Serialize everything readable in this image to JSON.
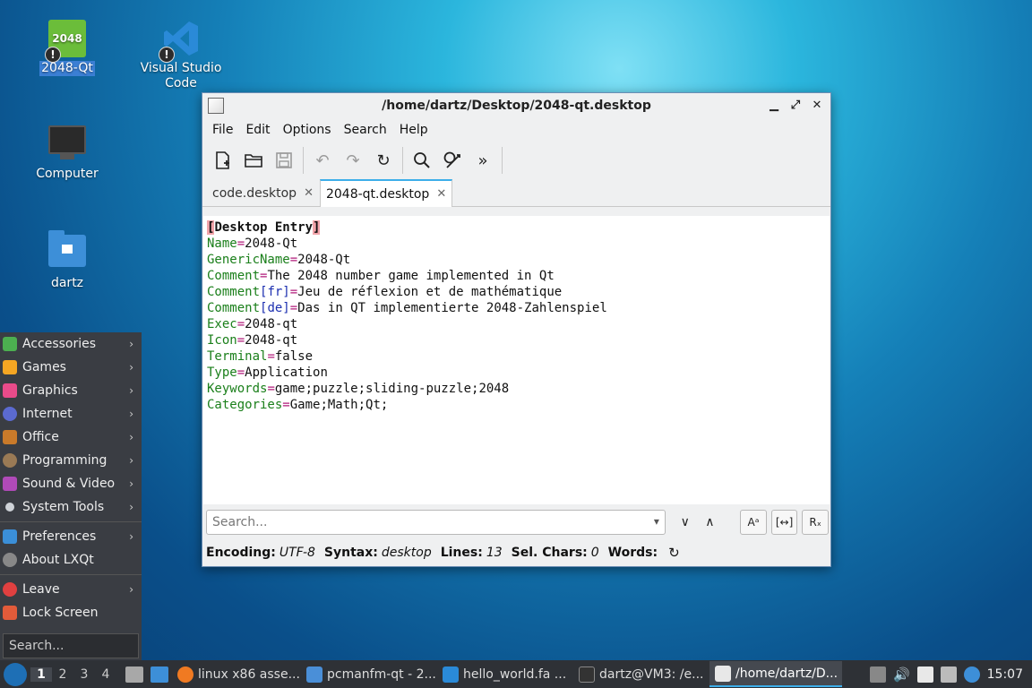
{
  "desktop": {
    "icons": [
      {
        "label": "2048-Qt",
        "image_text": "2048"
      },
      {
        "label": "Visual Studio\nCode"
      },
      {
        "label": "Computer"
      },
      {
        "label": "dartz"
      }
    ]
  },
  "window": {
    "title": "/home/dartz/Desktop/2048-qt.desktop",
    "controls": [
      "▁",
      "⤢",
      "✕"
    ],
    "menu": [
      "File",
      "Edit",
      "Options",
      "Search",
      "Help"
    ],
    "tabs": [
      {
        "label": "code.desktop",
        "active": false
      },
      {
        "label": "2048-qt.desktop",
        "active": true
      }
    ],
    "lines": [
      {
        "section": "Desktop Entry"
      },
      {
        "key": "Name",
        "value": "2048-Qt"
      },
      {
        "key": "GenericName",
        "value": "2048-Qt"
      },
      {
        "key": "Comment",
        "value": "The 2048 number game implemented in Qt"
      },
      {
        "key": "Comment",
        "locale": "[fr]",
        "value": "Jeu de réflexion et de mathématique"
      },
      {
        "key": "Comment",
        "locale": "[de]",
        "value": "Das in QT implementierte 2048-Zahlenspiel"
      },
      {
        "key": "Exec",
        "value": "2048-qt"
      },
      {
        "key": "Icon",
        "value": "2048-qt"
      },
      {
        "key": "Terminal",
        "value": "false"
      },
      {
        "key": "Type",
        "value": "Application"
      },
      {
        "key": "Keywords",
        "value": "game;puzzle;sliding-puzzle;2048"
      },
      {
        "key": "Categories",
        "value": "Game;Math;Qt;"
      }
    ],
    "search": {
      "placeholder": "Search..."
    },
    "search_options": [
      "Aᵃ",
      "[↔]",
      "Rₓ"
    ],
    "status": {
      "encoding_label": "Encoding:",
      "encoding": "UTF-8",
      "syntax_label": "Syntax:",
      "syntax": "desktop",
      "lines_label": "Lines:",
      "lines": "13",
      "sel_label": "Sel. Chars:",
      "sel": "0",
      "words_label": "Words:"
    }
  },
  "start_menu": {
    "items": [
      {
        "label": "Accessories",
        "color": "#4caf50",
        "submenu": true
      },
      {
        "label": "Games",
        "color": "#f5a623",
        "submenu": true
      },
      {
        "label": "Graphics",
        "color": "#e94b8a",
        "submenu": true
      },
      {
        "label": "Internet",
        "color": "#5b6ad0",
        "submenu": true
      },
      {
        "label": "Office",
        "color": "#c97a2a",
        "submenu": true
      },
      {
        "label": "Programming",
        "color": "#9a7a55",
        "submenu": true
      },
      {
        "label": "Sound & Video",
        "color": "#b04ab8",
        "submenu": true
      },
      {
        "label": "System Tools",
        "color": "#cfd3d8",
        "submenu": true
      }
    ],
    "items2": [
      {
        "label": "Preferences",
        "color": "#3b8fd8",
        "submenu": true
      },
      {
        "label": "About LXQt",
        "color": "#888888",
        "submenu": false
      }
    ],
    "items3": [
      {
        "label": "Leave",
        "color": "#e04040",
        "submenu": true
      },
      {
        "label": "Lock Screen",
        "color": "#e25b3a",
        "submenu": false
      }
    ],
    "search_placeholder": "Search..."
  },
  "taskbar": {
    "desktops": [
      "1",
      "2",
      "3",
      "4"
    ],
    "tasks": [
      {
        "label": "linux x86 asse...",
        "color": "#f07a22",
        "active": false
      },
      {
        "label": "pcmanfm-qt - 2...",
        "color": "#4a8fd8",
        "active": false
      },
      {
        "label": "hello_world.fa ...",
        "color": "#2a8ad8",
        "active": false
      },
      {
        "label": "dartz@VM3: /e...",
        "color": "#333",
        "active": false
      },
      {
        "label": "/home/dartz/D...",
        "color": "#e8e8e8",
        "active": true
      }
    ],
    "clock": "15:07"
  }
}
